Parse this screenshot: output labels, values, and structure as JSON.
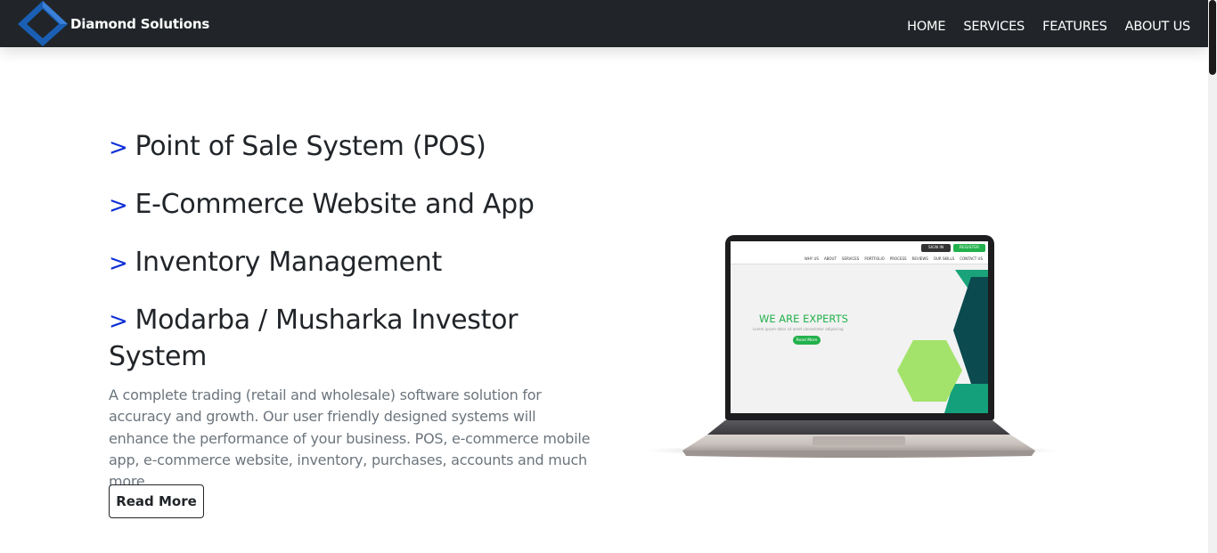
{
  "navbar": {
    "brand_name": "Diamond Solutions",
    "links": [
      "HOME",
      "SERVICES",
      "FEATURES",
      "ABOUT US"
    ],
    "bg_color": "#212529"
  },
  "services": [
    {
      "arrow": ">",
      "label": "Point of Sale System (POS)"
    },
    {
      "arrow": ">",
      "label": "E-Commerce Website and App"
    },
    {
      "arrow": ">",
      "label": "Inventory Management"
    },
    {
      "arrow": ">",
      "label": "Modarba / Musharka Investor System"
    }
  ],
  "description": "A complete trading (retail and wholesale) software solution for accuracy and growth. Our user friendly designed systems will enhance the performance of your business. POS, e-commerce mobile app, e-commerce website, inventory, purchases, accounts and much more.",
  "read_more_label": "Read More",
  "laptop_screen": {
    "sign_in": "SIGN IN",
    "register": "REGISTER",
    "nav": [
      "WHY US",
      "ABOUT",
      "SERVICES",
      "PORTFOLIO",
      "PROCESS",
      "REVIEWS",
      "OUR SKILLS",
      "CONTACT US"
    ],
    "hero_title": "WE ARE EXPERTS",
    "hero_subtitle": "Lorem ipsum dolor sit amet consectetur adipiscing",
    "read_more": "Read More"
  },
  "colors": {
    "accent_arrow": "#0d2fd6",
    "text_dark": "#212529",
    "text_muted": "#6c757d",
    "logo_blue": "#1a5fb4",
    "screen_green": "#22b14c"
  }
}
